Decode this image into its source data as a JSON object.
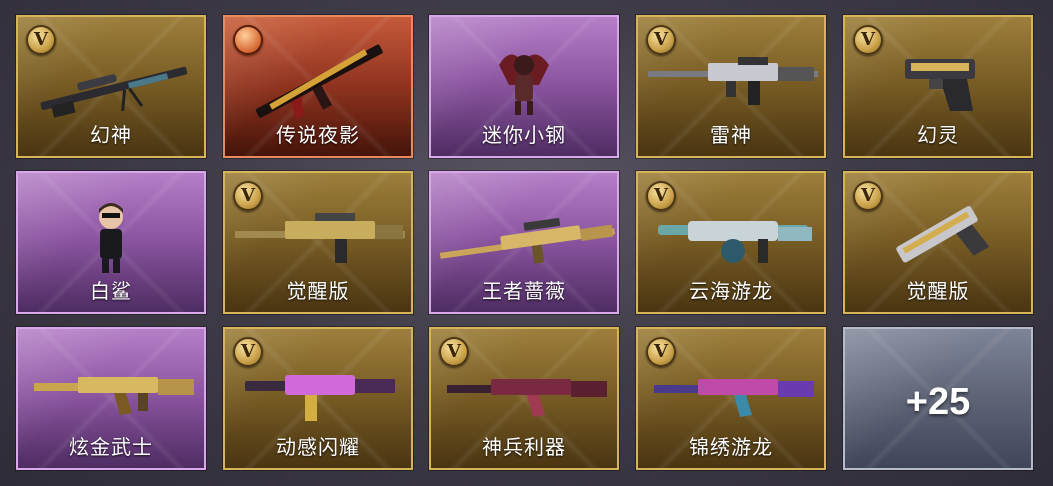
{
  "items": [
    {
      "label": "幻神",
      "rarity": "gold",
      "badge": "V",
      "icon": "sniper-rifle-icon"
    },
    {
      "label": "传说夜影",
      "rarity": "red",
      "badge": "legend",
      "icon": "rifle-icon"
    },
    {
      "label": "迷你小钢",
      "rarity": "purple",
      "badge": "",
      "icon": "mini-mech-figure-icon"
    },
    {
      "label": "雷神",
      "rarity": "gold",
      "badge": "V",
      "icon": "assault-rifle-icon"
    },
    {
      "label": "幻灵",
      "rarity": "gold",
      "badge": "V",
      "icon": "pistol-icon"
    },
    {
      "label": "白鲨",
      "rarity": "purple",
      "badge": "",
      "icon": "character-figure-icon"
    },
    {
      "label": "觉醒版",
      "rarity": "gold",
      "badge": "V",
      "icon": "assault-rifle-icon"
    },
    {
      "label": "王者蔷薇",
      "rarity": "purple",
      "badge": "",
      "icon": "sniper-rifle-icon"
    },
    {
      "label": "云海游龙",
      "rarity": "gold",
      "badge": "V",
      "icon": "smg-icon"
    },
    {
      "label": "觉醒版",
      "rarity": "gold",
      "badge": "V",
      "icon": "pistol-icon"
    },
    {
      "label": "炫金武士",
      "rarity": "purple",
      "badge": "",
      "icon": "ak-rifle-icon"
    },
    {
      "label": "动感闪耀",
      "rarity": "gold",
      "badge": "V",
      "icon": "rifle-icon"
    },
    {
      "label": "神兵利器",
      "rarity": "gold",
      "badge": "V",
      "icon": "ak-rifle-icon"
    },
    {
      "label": "锦绣游龙",
      "rarity": "gold",
      "badge": "V",
      "icon": "ak-rifle-icon"
    }
  ],
  "more": {
    "label": "+25"
  },
  "colors": {
    "gold": "#d6b558",
    "purple": "#d9a8ea",
    "red": "#e88a5c",
    "silver": "#b7bccb"
  }
}
